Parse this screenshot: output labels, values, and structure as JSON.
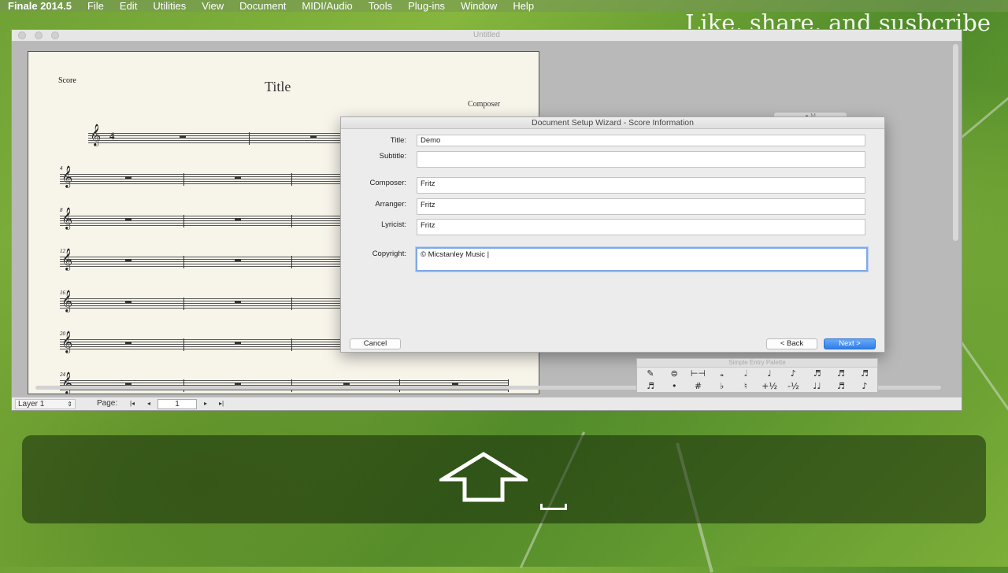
{
  "menubar": {
    "app": "Finale 2014.5",
    "items": [
      "File",
      "Edit",
      "Utilities",
      "View",
      "Document",
      "MIDI/Audio",
      "Tools",
      "Plug-ins",
      "Window",
      "Help"
    ]
  },
  "watermark": "Like, share, and susbcribe",
  "window": {
    "title": "Untitled"
  },
  "score": {
    "label": "Score",
    "title": "Title",
    "composer": "Composer",
    "time_signature": "4",
    "measure_numbers": [
      "4",
      "8",
      "12",
      "16",
      "20",
      "24"
    ]
  },
  "statusbar": {
    "layer": "Layer 1",
    "page_label": "Page:",
    "page_value": "1"
  },
  "dialog": {
    "title": "Document Setup Wizard - Score Information",
    "fields": {
      "title_label": "Title:",
      "title_value": "Demo",
      "subtitle_label": "Subtitle:",
      "subtitle_value": "",
      "composer_label": "Composer:",
      "composer_value": "Fritz",
      "arranger_label": "Arranger:",
      "arranger_value": "Fritz",
      "lyricist_label": "Lyricist:",
      "lyricist_value": "Fritz",
      "copyright_label": "Copyright:",
      "copyright_value": "© Micstanley Music |"
    },
    "buttons": {
      "cancel": "Cancel",
      "back": "< Back",
      "next": "Next >"
    },
    "accent_color": "#2f7ee8"
  },
  "palette": {
    "title": "Simple Entry Palette",
    "row1": [
      "✎",
      "⊜",
      "⊢⊣",
      "𝅝",
      "𝅗𝅥",
      "♩",
      "♪",
      "♬",
      "♬",
      "♬"
    ],
    "row2": [
      "♬",
      "•",
      "#",
      "♭",
      "♮",
      "+½",
      "-½",
      "♩♩",
      "♬",
      "♪"
    ]
  },
  "overlay_icons": [
    "shift-key-icon",
    "space-key-icon"
  ]
}
